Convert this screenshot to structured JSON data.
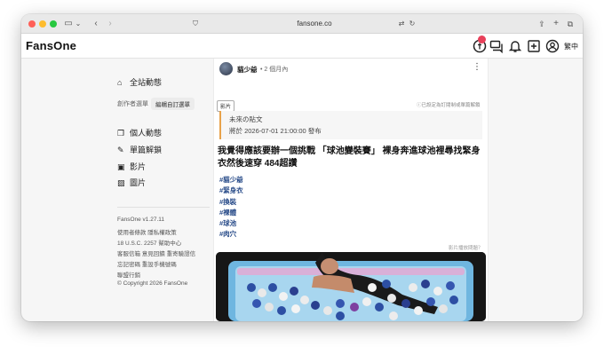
{
  "browser": {
    "url": "fansone.co",
    "colors": {
      "close": "#ff5f57",
      "minimize": "#febc2e",
      "maximize": "#28c840"
    }
  },
  "header": {
    "logo": "FansOne",
    "notification_count": "",
    "language": "繁中",
    "icons": [
      "coin-icon",
      "chat-icon",
      "bell-icon",
      "add-post-icon",
      "profile-icon"
    ]
  },
  "sidebar": {
    "home": "全站動態",
    "creator_menu_label": "創作者選單",
    "edit_menu": "編輯自訂選單",
    "items": [
      {
        "label": "個人動態",
        "icon": "personal-feed-icon"
      },
      {
        "label": "單篇解鎖",
        "icon": "unlock-icon"
      },
      {
        "label": "影片",
        "icon": "video-icon"
      },
      {
        "label": "圖片",
        "icon": "image-icon"
      }
    ],
    "footer": {
      "version": "FansOne v1.27.11",
      "line1": "使用者條款  隱私權政策",
      "line2": "18 U.S.C. 2257  幫助中心",
      "line3": "客服信箱  意見回饋  重寄驗證信",
      "line4": "忘記密碼  重設手機號碼",
      "line5": "聯盟行銷",
      "copyright": "© Copyright 2026 FansOne"
    }
  },
  "post": {
    "author": "貓少爺",
    "time_ago": "• 2 個月內",
    "type_tag": "影片",
    "subscribe_hint": "ⓘ已設定為訂閱制或單篇解鎖",
    "future_title": "未來の貼文",
    "future_time": "將於 2026-07-01 21:00:00 發布",
    "title": "我覺得應該要辦一個挑戰 「球池變裝賽」 裸身奔進球池裡尋找緊身衣然後速穿 484超讚",
    "hashtags": [
      "#貓少爺",
      "#緊身衣",
      "#換裝",
      "#裸體",
      "#球池",
      "#肉穴"
    ],
    "video_hint": "影片播放問題？",
    "accent_color": "#e8a24a",
    "hashtag_color": "#2a4d8a"
  }
}
